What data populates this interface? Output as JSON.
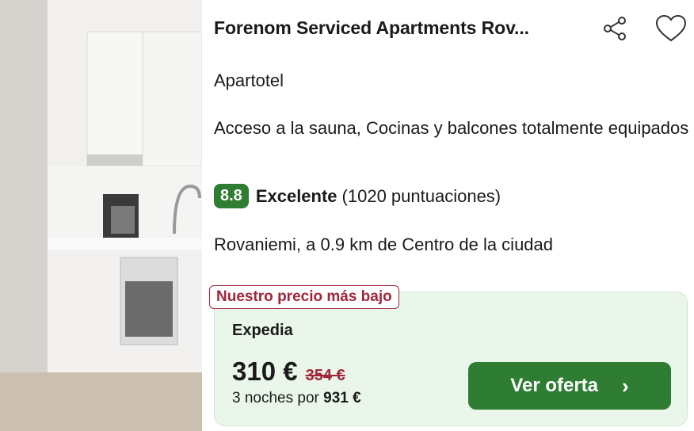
{
  "hotel": {
    "name": "Forenom Serviced Apartments Rov...",
    "type": "Apartotel",
    "amenities": "Acceso a la sauna, Cocinas y balcones totalmente equipados",
    "score": "8.8",
    "rating_word": "Excelente",
    "rating_count": "(1020 puntuaciones)",
    "location": "Rovaniemi, a 0.9 km de Centro de la ciudad"
  },
  "deal": {
    "badge": "Nuestro precio más bajo",
    "provider": "Expedia",
    "price": "310 €",
    "old_price": "354 €",
    "nights_text": "3 noches por ",
    "total": "931 €",
    "cta": "Ver oferta"
  },
  "icons": {
    "share": "share-icon",
    "favorite": "heart-icon",
    "chevron": "chevron-right-icon"
  },
  "colors": {
    "accent_green": "#2e7d32",
    "deal_bg": "#eaf6ea",
    "badge_red": "#a0263a"
  }
}
